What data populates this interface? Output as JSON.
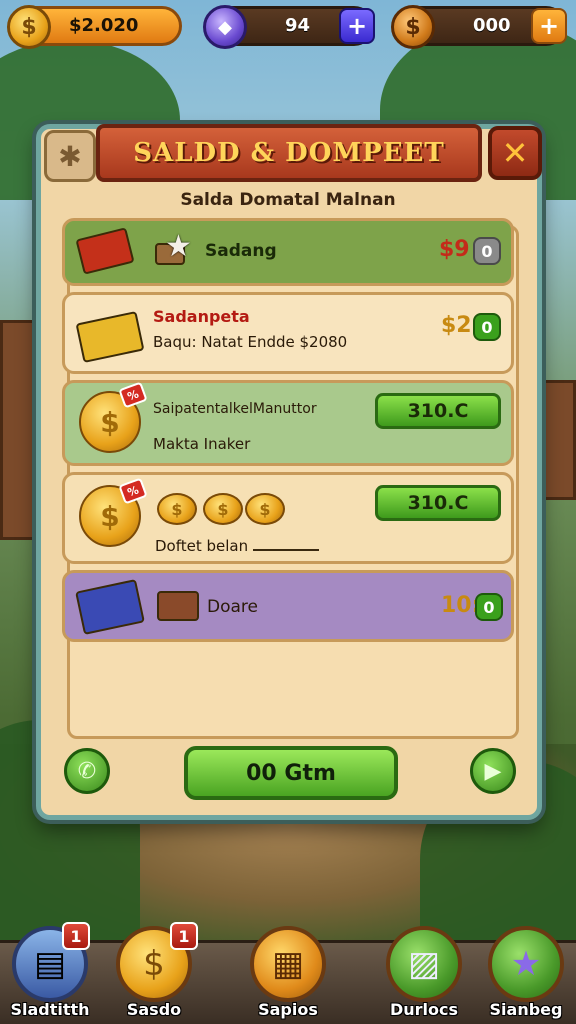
{
  "topbar": {
    "gold": {
      "value": "$2.020"
    },
    "gems": {
      "value": "94"
    },
    "coins": {
      "value": "000"
    }
  },
  "panel": {
    "title": "SALDD & DOMPEET",
    "subtitle": "Salda Domatal Malnan"
  },
  "rows": [
    {
      "label": "Sadang",
      "price": "$9",
      "badge": ""
    },
    {
      "label": "Sadanpeta",
      "sub": "Baqu: Natat Endde $2080",
      "price": "$2"
    },
    {
      "label": "SaipatentalkelManuttor",
      "sub": "Makta Inaker",
      "button": "310.C",
      "tag": "%"
    },
    {
      "label": "Doftet belan",
      "button": "310.C",
      "tag": "%"
    },
    {
      "label": "Doare",
      "price": "10:"
    }
  ],
  "confirm_label": "00 Gtm",
  "nav": {
    "items": [
      {
        "label": "Sladtitth",
        "badge": "1"
      },
      {
        "label": "Sasdo",
        "badge": "1"
      },
      {
        "label": "Sapios"
      },
      {
        "label": "Durlocs"
      },
      {
        "label": "Sianbeg"
      }
    ]
  },
  "colors": {
    "accent_green": "#4aa422",
    "banner_red": "#a8381d",
    "gold": "#e8a21a",
    "panel_border": "#6fa6a0"
  },
  "icons": [
    "gold-coin-icon",
    "gem-icon",
    "coin-icon",
    "plus-icon",
    "gear-icon",
    "close-icon",
    "cash-icon",
    "star-icon",
    "phone-icon",
    "play-icon",
    "card-icon",
    "money-stack-icon",
    "scroll-icon",
    "badge-icon"
  ]
}
